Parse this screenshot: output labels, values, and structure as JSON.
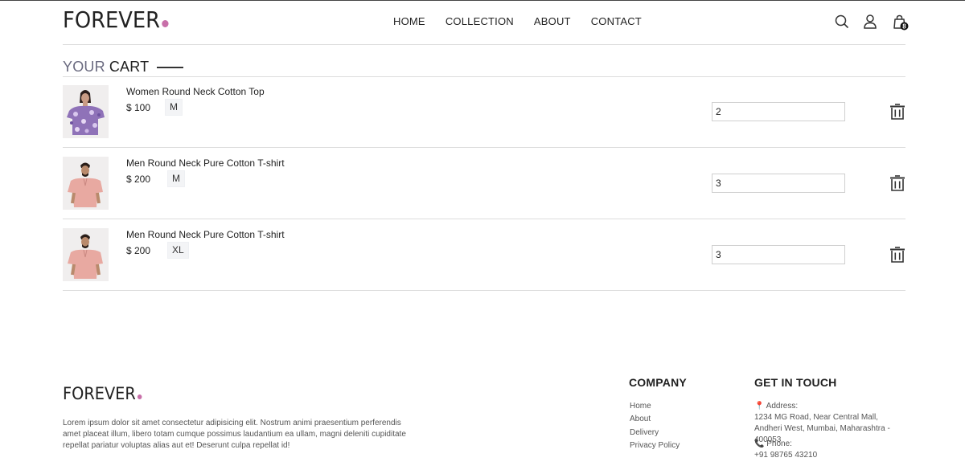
{
  "brand": {
    "name": "FOREVER",
    "dot_color": "#c86fa9"
  },
  "nav": [
    {
      "label": "HOME"
    },
    {
      "label": "COLLECTION"
    },
    {
      "label": "ABOUT"
    },
    {
      "label": "CONTACT"
    }
  ],
  "header_icons": [
    "search-icon",
    "user-icon",
    "cart-icon"
  ],
  "cart_badge": "8",
  "cart_title": {
    "part1": "YOUR",
    "part2": "CART"
  },
  "items": [
    {
      "name": "Women Round Neck Cotton Top",
      "price": "$ 100",
      "size": "M",
      "quantity": "2"
    },
    {
      "name": "Men Round Neck Pure Cotton T-shirt",
      "price": "$ 200",
      "size": "M",
      "quantity": "3"
    },
    {
      "name": "Men Round Neck Pure Cotton T-shirt",
      "price": "$ 200",
      "size": "XL",
      "quantity": "3"
    }
  ],
  "footer": {
    "description": "Lorem ipsum dolor sit amet consectetur adipisicing elit. Nostrum animi praesentium perferendis amet placeat illum, libero totam cumque possimus laudantium ea ullam, magni deleniti cupiditate repellat pariatur voluptas alias aut et! Deserunt culpa repellat id!",
    "company_heading": "COMPANY",
    "company_links": [
      "Home",
      "About",
      "Delivery",
      "Privacy Policy"
    ],
    "contact_heading": "GET IN TOUCH",
    "address_label": "📍 Address:",
    "address": "1234 MG Road, Near Central Mall, Andheri West, Mumbai, Maharashtra - 400053",
    "phone_label": "📞 Phone:",
    "phone": "+91 98765 43210"
  }
}
